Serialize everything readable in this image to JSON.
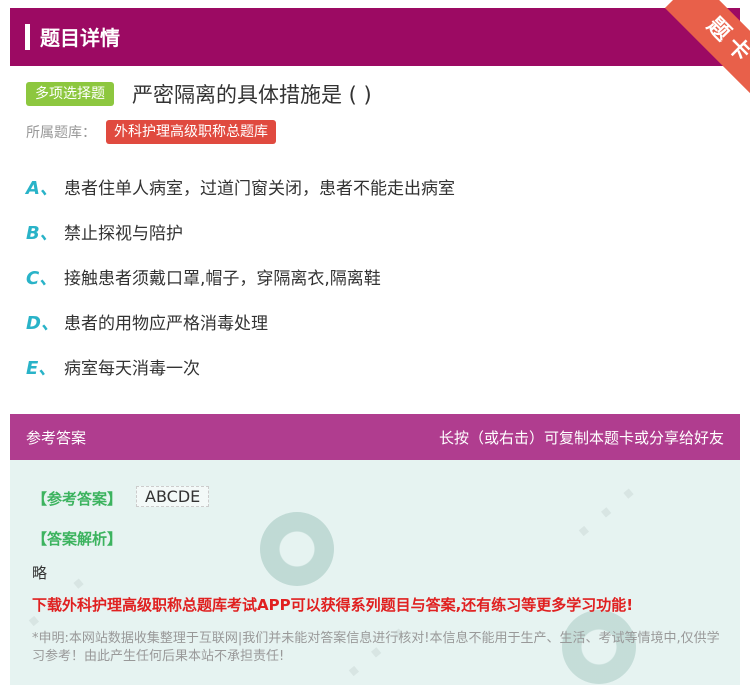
{
  "header": {
    "title": "题目详情",
    "corner_badge": "题卡"
  },
  "question": {
    "type_label": "多项选择题",
    "title": "严密隔离的具体措施是 ( )",
    "source_label": "所属题库：",
    "source_tag": "外科护理高级职称总题库",
    "options": [
      {
        "letter": "A、",
        "text": "患者住单人病室，过道门窗关闭，患者不能走出病室"
      },
      {
        "letter": "B、",
        "text": "禁止探视与陪护"
      },
      {
        "letter": "C、",
        "text": "接触患者须戴口罩,帽子，穿隔离衣,隔离鞋"
      },
      {
        "letter": "D、",
        "text": "患者的用物应严格消毒处理"
      },
      {
        "letter": "E、",
        "text": "病室每天消毒一次"
      }
    ]
  },
  "answer_bar": {
    "left": "参考答案",
    "right": "长按（或右击）可复制本题卡或分享给好友"
  },
  "answer": {
    "answer_label": "【参考答案】",
    "answer_value": "ABCDE",
    "analysis_label": "【答案解析】",
    "analysis_text": "略",
    "promo": "下载外科护理高级职称总题库考试APP可以获得系列题目与答案,还有练习等更多学习功能!",
    "disclaimer": "*申明:本网站数据收集整理于互联网|我们并未能对答案信息进行核对!本信息不能用于生产、生活、考试等情境中,仅供学习参考！由此产生任何后果本站不承担责任!"
  },
  "colors": {
    "header": "#9c0a63",
    "answer_bar": "#b03d8f",
    "accent_letter": "#29b3c8",
    "type_badge": "#8dc73f",
    "source_tag": "#e04a3f",
    "promo": "#e02020"
  }
}
